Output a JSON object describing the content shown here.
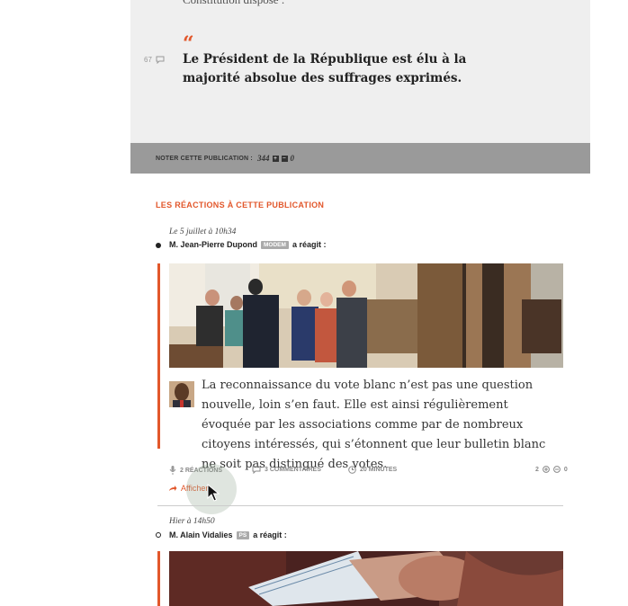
{
  "quote": {
    "previous_line": "Constitution dispose :",
    "mark": "“",
    "comment_count": "67",
    "text": "Le Président de la République est élu à la majorité absolue des suffrages exprimés."
  },
  "rating": {
    "label": "NOTER CETTE PUBLICATION :",
    "count": "344",
    "plus_icon": "+",
    "minus_icon": "−",
    "minus_count": "0"
  },
  "reactions": {
    "heading": "LES RÉACTIONS À CETTE PUBLICATION",
    "items": [
      {
        "date": "Le 5 juillet à 10h34",
        "author": "M. Jean-Pierre Dupond",
        "party": "MODEM",
        "action": "a réagit :",
        "text": "La reconnaissance du vote blanc n’est pas une question nouvelle, loin s’en faut. Elle est ainsi régulièrement évoquée par les associations comme par de nombreux citoyens intéressés, qui s’étonnent que leur bulletin blanc ne soit pas distingué des votes.",
        "stats": {
          "reactions": "2 RÉACTIONS",
          "comments": "3 COMMENTAIRES",
          "duration": "20 MINUTES",
          "votes": "2",
          "votes_minus": "0"
        },
        "show_label": "Afficher"
      },
      {
        "date": "Hier à 14h50",
        "author": "M. Alain Vidalies",
        "party": "PS",
        "action": "a réagit :"
      }
    ]
  },
  "colors": {
    "accent": "#e2572b",
    "panel": "#efefef",
    "rating_bar": "#9a9a9a"
  },
  "icons": {
    "comment": "comment-bubble-icon",
    "reactions": "microphone-icon",
    "duration": "clock-icon",
    "show": "arrow-share-icon",
    "cursor": "mouse-pointer-icon"
  }
}
